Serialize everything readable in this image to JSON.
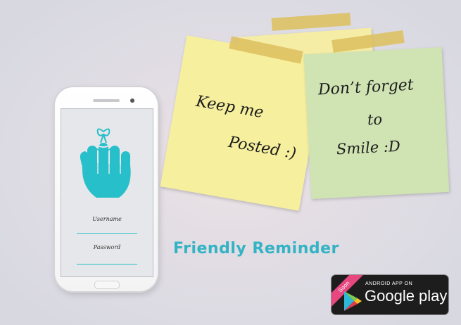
{
  "phone": {
    "username_placeholder": "Username",
    "password_placeholder": "Password"
  },
  "notes": {
    "yellow": {
      "line1": "Keep me",
      "line2": "Posted :)"
    },
    "green": {
      "line1": "Don’t forget",
      "line2": "to",
      "line3": "Smile  :D"
    }
  },
  "title": "Friendly Reminder",
  "badge": {
    "ribbon": "Soon",
    "small_text": "ANDROID APP ON",
    "store_name": "Google play"
  },
  "colors": {
    "accent": "#33b3c4",
    "hand": "#27bfca",
    "note_yellow": "#f6ef9e",
    "note_green": "#cfe3b3",
    "ribbon": "#e6477f"
  },
  "icons": {
    "hand": "finger-with-string-icon",
    "play": "google-play-triangle-icon"
  }
}
